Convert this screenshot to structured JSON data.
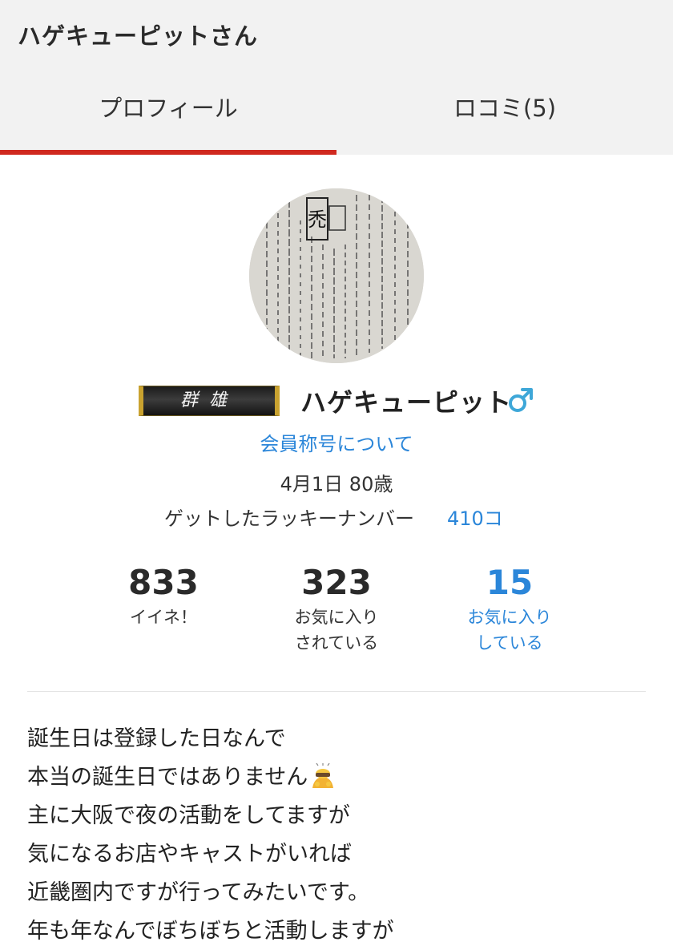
{
  "header": {
    "title": "ハゲキューピットさん"
  },
  "tabs": [
    {
      "label": "プロフィール",
      "active": true
    },
    {
      "label": "ロコミ(5)",
      "active": false
    }
  ],
  "colors": {
    "accent": "#d0291f",
    "link": "#2b86d9",
    "header_bg": "#f2f2f2"
  },
  "profile": {
    "title_badge": "群雄",
    "name": "ハゲキューピット",
    "gender_icon": "male-icon",
    "member_title_link": "会員称号について",
    "birthday": "4月1日 80歳",
    "lucky_label": "ゲットしたラッキーナンバー",
    "lucky_value": "410コ"
  },
  "stats": [
    {
      "value": "833",
      "label": "イイネ！"
    },
    {
      "value": "323",
      "label": "お気に入り\nされている"
    },
    {
      "value": "15",
      "label": "お気に入り\nしている"
    }
  ],
  "bio": [
    "誕生日は登録した日なんで",
    "本当の誕生日ではありません",
    "主に大阪で夜の活動をしてますが",
    "気になるお店やキャストがいれば",
    "近畿圏内ですが行ってみたいです。",
    "年も年なんでぼちぼちと活動しますが"
  ],
  "bio_emoji": "bowing-person-icon"
}
